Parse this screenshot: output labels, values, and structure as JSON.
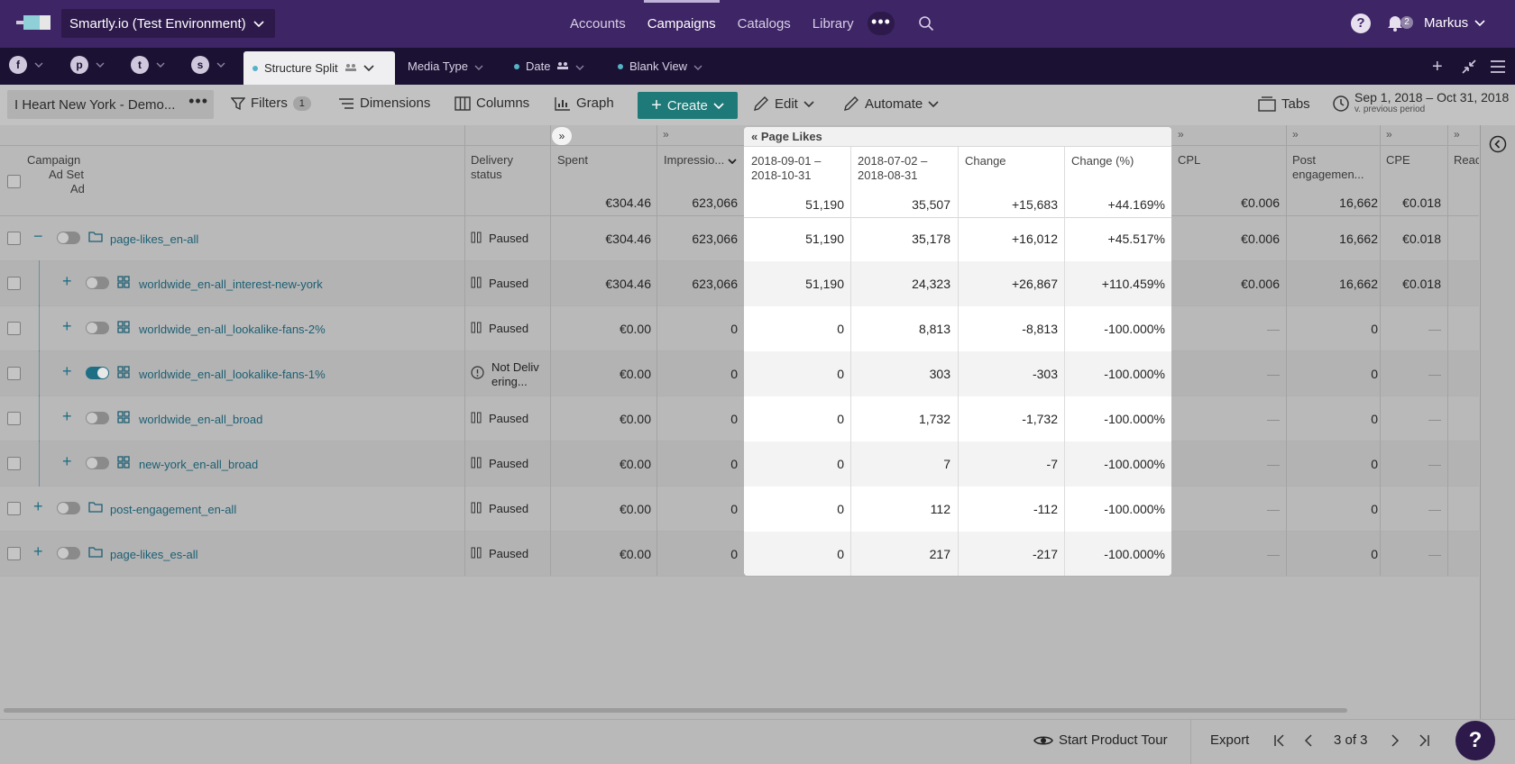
{
  "topbar": {
    "environment": "Smartly.io (Test Environment)",
    "nav": [
      "Accounts",
      "Campaigns",
      "Catalogs",
      "Library"
    ],
    "active_nav": "Campaigns",
    "more": "•••",
    "notifications": "2",
    "user": "Markus"
  },
  "view_tabs": [
    {
      "label": "Structure Split",
      "active": true
    },
    {
      "label": "Media Type",
      "active": false
    },
    {
      "label": "Date",
      "active": false
    },
    {
      "label": "Blank View",
      "active": false
    }
  ],
  "toolbar": {
    "account": "I Heart New York - Demo...",
    "filters": "Filters",
    "filters_count": "1",
    "dimensions": "Dimensions",
    "columns": "Columns",
    "graph": "Graph",
    "create": "Create",
    "edit": "Edit",
    "automate": "Automate",
    "tabs": "Tabs",
    "date_range": "Sep 1, 2018 – Oct 31, 2018",
    "date_compare": "v. previous period"
  },
  "grid": {
    "hierarchy": {
      "campaign": "Campaign",
      "adset": "Ad Set",
      "ad": "Ad"
    },
    "columns": {
      "delivery": "Delivery status",
      "spent": "Spent",
      "impressions": "Impressio...",
      "group": "Page Likes",
      "current": "2018-09-01 – 2018-10-31",
      "previous": "2018-07-02 – 2018-08-31",
      "change": "Change",
      "change_pct": "Change (%)",
      "cpl": "CPL",
      "post_eng": "Post engagemen...",
      "cpe": "CPE",
      "reach": "Reac"
    },
    "totals": {
      "spent": "€304.46",
      "impressions": "623,066",
      "current": "51,190",
      "previous": "35,507",
      "change": "+15,683",
      "change_pct": "+44.169%",
      "cpl": "€0.006",
      "post_eng": "16,662",
      "cpe": "€0.018"
    },
    "rows": [
      {
        "name": "page-likes_en-all",
        "level": "campaign",
        "expand": "−",
        "toggle": false,
        "status": "Paused",
        "spent": "€304.46",
        "impressions": "623,066",
        "current": "51,190",
        "previous": "35,178",
        "change": "+16,012",
        "change_pct": "+45.517%",
        "cpl": "€0.006",
        "post_eng": "16,662",
        "cpe": "€0.018"
      },
      {
        "name": "worldwide_en-all_interest-new-york",
        "level": "adset",
        "expand": "+",
        "toggle": false,
        "status": "Paused",
        "spent": "€304.46",
        "impressions": "623,066",
        "current": "51,190",
        "previous": "24,323",
        "change": "+26,867",
        "change_pct": "+110.459%",
        "cpl": "€0.006",
        "post_eng": "16,662",
        "cpe": "€0.018"
      },
      {
        "name": "worldwide_en-all_lookalike-fans-2%",
        "level": "adset",
        "expand": "+",
        "toggle": false,
        "status": "Paused",
        "spent": "€0.00",
        "impressions": "0",
        "current": "0",
        "previous": "8,813",
        "change": "-8,813",
        "change_pct": "-100.000%",
        "cpl": "—",
        "post_eng": "0",
        "cpe": "—"
      },
      {
        "name": "worldwide_en-all_lookalike-fans-1%",
        "level": "adset",
        "expand": "+",
        "toggle": true,
        "status": "Not Deliv ering...",
        "spent": "€0.00",
        "impressions": "0",
        "current": "0",
        "previous": "303",
        "change": "-303",
        "change_pct": "-100.000%",
        "cpl": "—",
        "post_eng": "0",
        "cpe": "—"
      },
      {
        "name": "worldwide_en-all_broad",
        "level": "adset",
        "expand": "+",
        "toggle": false,
        "status": "Paused",
        "spent": "€0.00",
        "impressions": "0",
        "current": "0",
        "previous": "1,732",
        "change": "-1,732",
        "change_pct": "-100.000%",
        "cpl": "—",
        "post_eng": "0",
        "cpe": "—"
      },
      {
        "name": "new-york_en-all_broad",
        "level": "adset",
        "expand": "+",
        "toggle": false,
        "status": "Paused",
        "spent": "€0.00",
        "impressions": "0",
        "current": "0",
        "previous": "7",
        "change": "-7",
        "change_pct": "-100.000%",
        "cpl": "—",
        "post_eng": "0",
        "cpe": "—"
      },
      {
        "name": "post-engagement_en-all",
        "level": "campaign",
        "expand": "+",
        "toggle": false,
        "status": "Paused",
        "spent": "€0.00",
        "impressions": "0",
        "current": "0",
        "previous": "112",
        "change": "-112",
        "change_pct": "-100.000%",
        "cpl": "—",
        "post_eng": "0",
        "cpe": "—"
      },
      {
        "name": "page-likes_es-all",
        "level": "campaign",
        "expand": "+",
        "toggle": false,
        "status": "Paused",
        "spent": "€0.00",
        "impressions": "0",
        "current": "0",
        "previous": "217",
        "change": "-217",
        "change_pct": "-100.000%",
        "cpl": "—",
        "post_eng": "0",
        "cpe": "—"
      }
    ]
  },
  "footer": {
    "tour": "Start Product Tour",
    "export": "Export",
    "pagination": "3 of 3"
  },
  "colors": {
    "topbar": "#3e2565",
    "tabbar": "#1b1133",
    "accent": "#1d7a78",
    "link": "#1c5f73"
  }
}
